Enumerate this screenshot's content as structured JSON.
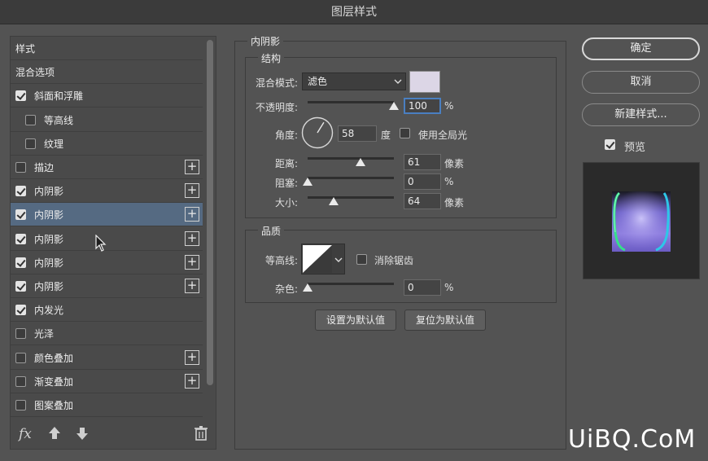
{
  "window": {
    "title": "图层样式"
  },
  "style_list": {
    "items": [
      {
        "label": "样式",
        "checkbox": "none",
        "plus": false,
        "indent": 0,
        "selected": false
      },
      {
        "label": "混合选项",
        "checkbox": "none",
        "plus": false,
        "indent": 0,
        "selected": false
      },
      {
        "label": "斜面和浮雕",
        "checkbox": "on",
        "plus": false,
        "indent": 0,
        "selected": false
      },
      {
        "label": "等高线",
        "checkbox": "off",
        "plus": false,
        "indent": 1,
        "selected": false
      },
      {
        "label": "纹理",
        "checkbox": "off",
        "plus": false,
        "indent": 1,
        "selected": false
      },
      {
        "label": "描边",
        "checkbox": "off",
        "plus": true,
        "indent": 0,
        "selected": false
      },
      {
        "label": "内阴影",
        "checkbox": "on",
        "plus": true,
        "indent": 0,
        "selected": false
      },
      {
        "label": "内阴影",
        "checkbox": "on",
        "plus": true,
        "indent": 0,
        "selected": true
      },
      {
        "label": "内阴影",
        "checkbox": "on",
        "plus": true,
        "indent": 0,
        "selected": false
      },
      {
        "label": "内阴影",
        "checkbox": "on",
        "plus": true,
        "indent": 0,
        "selected": false
      },
      {
        "label": "内阴影",
        "checkbox": "on",
        "plus": true,
        "indent": 0,
        "selected": false
      },
      {
        "label": "内发光",
        "checkbox": "on",
        "plus": false,
        "indent": 0,
        "selected": false
      },
      {
        "label": "光泽",
        "checkbox": "off",
        "plus": false,
        "indent": 0,
        "selected": false
      },
      {
        "label": "颜色叠加",
        "checkbox": "off",
        "plus": true,
        "indent": 0,
        "selected": false
      },
      {
        "label": "渐变叠加",
        "checkbox": "off",
        "plus": true,
        "indent": 0,
        "selected": false
      },
      {
        "label": "图案叠加",
        "checkbox": "off",
        "plus": false,
        "indent": 0,
        "selected": false
      }
    ],
    "tools": {
      "fx": "fx",
      "up_icon": "arrow-up-icon",
      "down_icon": "arrow-down-icon",
      "trash_icon": "trash-icon"
    }
  },
  "inner_shadow": {
    "section_title": "内阴影",
    "structure": {
      "title": "结构",
      "blend_mode_label": "混合模式:",
      "blend_mode_value": "滤色",
      "blend_color": "#dcd6e6",
      "opacity_label": "不透明度:",
      "opacity_value": "100",
      "opacity_unit": "%",
      "opacity_level": 1.0,
      "angle_label": "角度:",
      "angle_value": "58",
      "angle_unit": "度",
      "global_light_label": "使用全局光",
      "global_light_checked": false,
      "distance_label": "距离:",
      "distance_value": "61",
      "distance_unit": "像素",
      "distance_level": 0.61,
      "choke_label": "阻塞:",
      "choke_value": "0",
      "choke_unit": "%",
      "choke_level": 0.0,
      "size_label": "大小:",
      "size_value": "64",
      "size_unit": "像素",
      "size_level": 0.3
    },
    "quality": {
      "title": "品质",
      "contour_label": "等高线:",
      "anti_alias_label": "消除锯齿",
      "anti_alias_checked": false,
      "noise_label": "杂色:",
      "noise_value": "0",
      "noise_unit": "%",
      "noise_level": 0.0
    },
    "set_default_label": "设置为默认值",
    "reset_default_label": "复位为默认值"
  },
  "actions": {
    "ok_label": "确定",
    "cancel_label": "取消",
    "new_style_label": "新建样式...",
    "preview_label": "预览",
    "preview_checked": true
  },
  "watermark": "UiBQ.CoM"
}
